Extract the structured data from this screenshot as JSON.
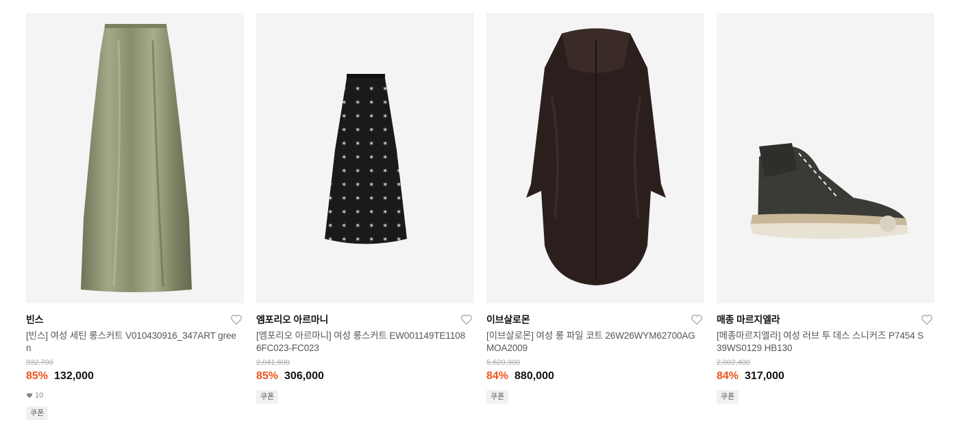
{
  "products": [
    {
      "brand": "빈스",
      "name": "[빈스] 여성 세틴 롱스커트 V010430916_347ART green",
      "original_price": "932,700",
      "discount": "85%",
      "price": "132,000",
      "likes": "10",
      "badge": "쿠폰",
      "image_icon": "satin-long-skirt-image"
    },
    {
      "brand": "엠포리오 아르마니",
      "name": "[엠포리오 아르마니] 여성 롱스커트 EW001149TE11086FC023-FC023",
      "original_price": "2,041,600",
      "discount": "85%",
      "price": "306,000",
      "badge": "쿠폰",
      "image_icon": "star-print-skirt-image"
    },
    {
      "brand": "이브살로몬",
      "name": "[이브살로몬] 여성 롱 파일 코트 26W26WYM62700AGMOA2009",
      "original_price": "5,620,300",
      "discount": "84%",
      "price": "880,000",
      "badge": "쿠폰",
      "image_icon": "fur-coat-image"
    },
    {
      "brand": "매종 마르지엘라",
      "name": "[메종마르지엘라] 여성 러브 투 데스 스니커즈 P7454 S39WS0129 HB130",
      "original_price": "2,002,400",
      "discount": "84%",
      "price": "317,000",
      "badge": "쿠폰",
      "image_icon": "high-top-sneaker-image"
    }
  ],
  "colors": {
    "discount": "#f0531c",
    "image_bg": "#f4f4f4"
  }
}
